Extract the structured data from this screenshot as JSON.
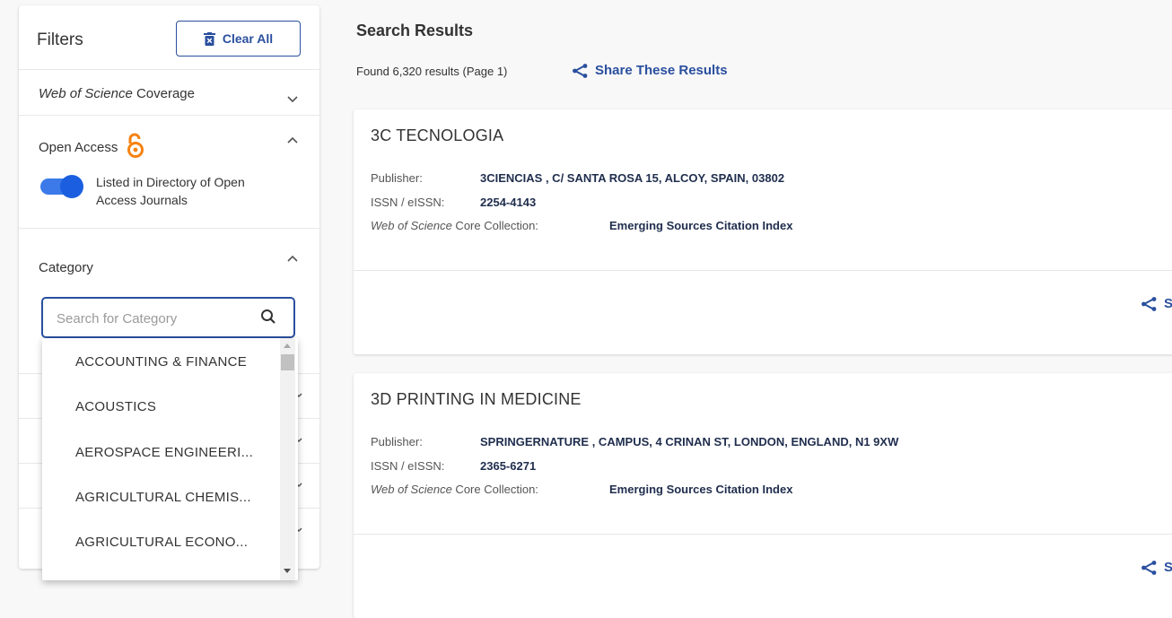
{
  "filters": {
    "title": "Filters",
    "clear_all": "Clear All",
    "wos_coverage": {
      "label_italic": "Web of Science",
      "label_rest": " Coverage"
    },
    "open_access": {
      "label": "Open Access",
      "toggle_label": "Listed in Directory of Open Access Journals",
      "toggle_on": true
    },
    "category": {
      "label": "Category",
      "search_placeholder": "Search for Category",
      "options": [
        "ACCOUNTING & FINANCE",
        "ACOUSTICS",
        "AEROSPACE ENGINEERI...",
        "AGRICULTURAL CHEMIS...",
        "AGRICULTURAL ECONO..."
      ]
    }
  },
  "results": {
    "title": "Search Results",
    "found": "Found 6,320 results (Page 1)",
    "share_label": "Share These Results",
    "labels": {
      "publisher": "Publisher:",
      "issn": "ISSN / eISSN:",
      "collection_italic": "Web of Science",
      "collection_rest": " Core Collection:"
    },
    "items": [
      {
        "title": "3C TECNOLOGIA",
        "publisher": "3CIENCIAS , C/ SANTA ROSA 15, ALCOY, SPAIN, 03802",
        "issn": "2254-4143",
        "collection": "Emerging Sources Citation Index",
        "share": "S"
      },
      {
        "title": "3D PRINTING IN MEDICINE",
        "publisher": "SPRINGERNATURE , CAMPUS, 4 CRINAN ST, LONDON, ENGLAND, N1 9XW",
        "issn": "2365-6271",
        "collection": "Emerging Sources Citation Index",
        "share": "S"
      }
    ]
  },
  "colors": {
    "accent": "#2a4f9e",
    "toggle": "#1b5fe0",
    "open_access_icon": "#f68212"
  },
  "icons": {
    "clear": "trash-icon",
    "share": "share-icon",
    "search": "search-icon",
    "chevron": "chevron-icon",
    "open_access": "open-access-lock-icon"
  }
}
